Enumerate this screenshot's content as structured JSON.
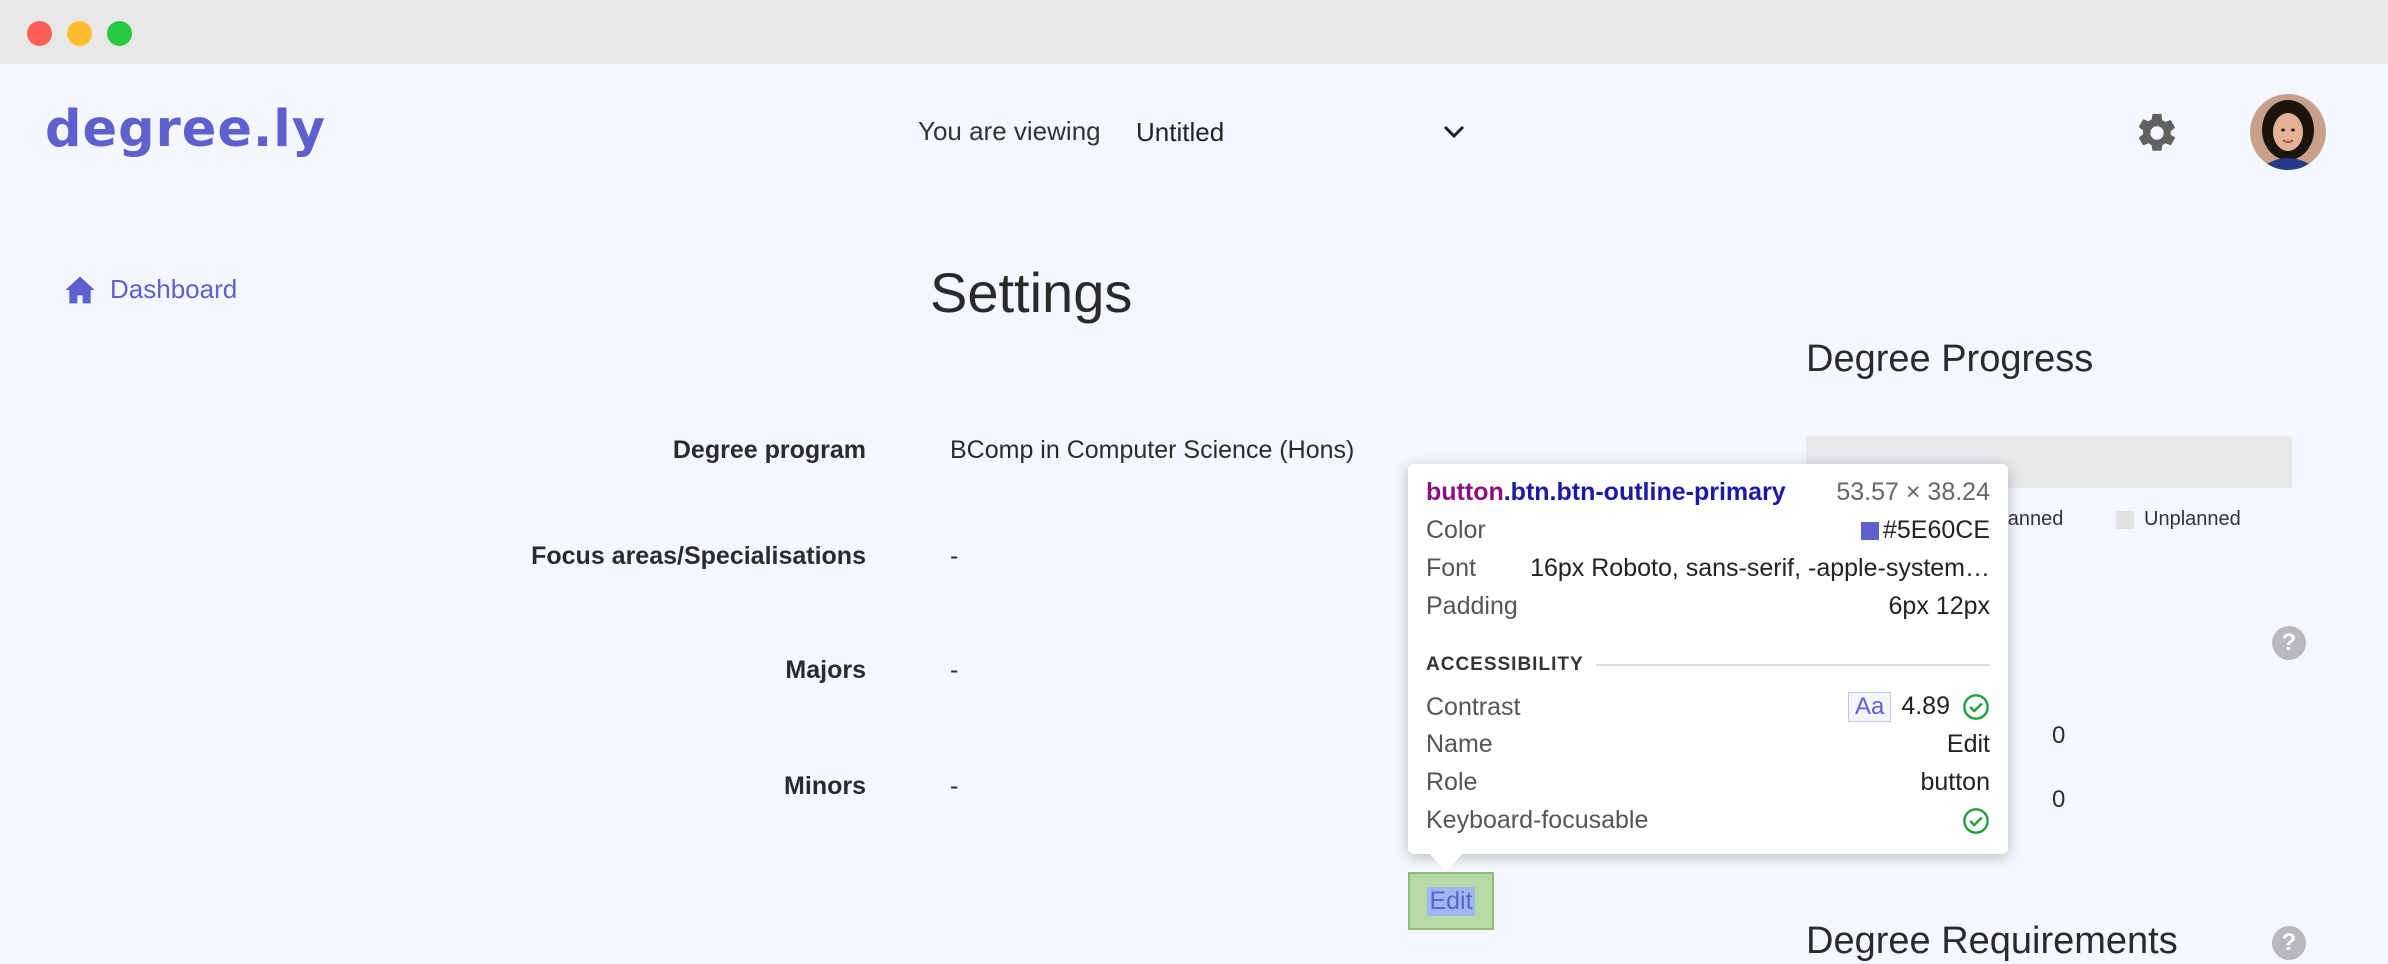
{
  "window": {
    "controls": [
      "close",
      "minimize",
      "maximize"
    ]
  },
  "header": {
    "logo": "degree.ly",
    "viewing_label": "You are viewing",
    "viewing_value": "Untitled",
    "settings_icon": "gear-icon",
    "avatar_icon": "avatar"
  },
  "sidebar": {
    "items": [
      {
        "label": "Dashboard",
        "icon": "home-icon"
      }
    ]
  },
  "main": {
    "title": "Settings",
    "rows": [
      {
        "label": "Degree program",
        "value": "BComp in Computer Science (Hons)"
      },
      {
        "label": "Focus areas/Specialisations",
        "value": "-"
      },
      {
        "label": "Majors",
        "value": "-"
      },
      {
        "label": "Minors",
        "value": "-"
      }
    ],
    "edit_label": "Edit"
  },
  "side": {
    "progress_title": "Degree Progress",
    "legend": [
      "Planned",
      "Unplanned"
    ],
    "counts": [
      "0",
      "0"
    ],
    "requirements_title": "Degree Requirements",
    "help_glyph": "?"
  },
  "inspector": {
    "tag": "button",
    "classes": ".btn.btn-outline-primary",
    "dims": "53.57 × 38.24",
    "color_label": "Color",
    "color_value": "#5E60CE",
    "font_label": "Font",
    "font_value": "16px Roboto, sans-serif, -apple-system…",
    "padding_label": "Padding",
    "padding_value": "6px 12px",
    "section": "ACCESSIBILITY",
    "contrast_label": "Contrast",
    "contrast_sample": "Aa",
    "contrast_value": "4.89",
    "name_label": "Name",
    "name_value": "Edit",
    "role_label": "Role",
    "role_value": "button",
    "focus_label": "Keyboard-focusable"
  },
  "colors": {
    "accent": "#5E60CE",
    "background": "#F4F7FD",
    "check": "#1E9E3A"
  }
}
